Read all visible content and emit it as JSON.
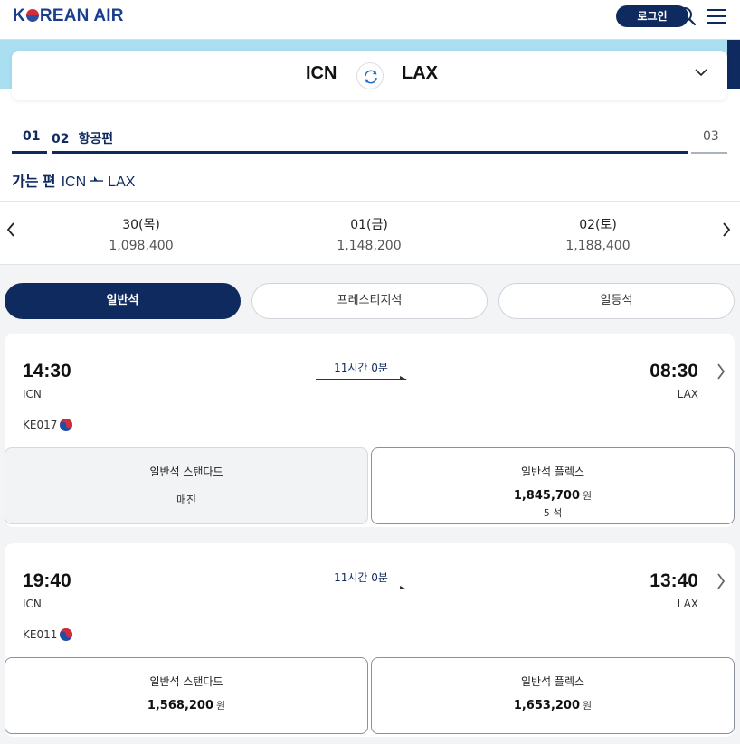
{
  "header": {
    "logo_text": "KOREAN AIR",
    "login_label": "로그인",
    "icons": [
      "search-icon",
      "menu-icon"
    ]
  },
  "route": {
    "from": "ICN",
    "to": "LAX"
  },
  "steps": [
    {
      "number": "01",
      "label": ""
    },
    {
      "number": "02",
      "label": "항공편"
    },
    {
      "number": "03",
      "label": ""
    }
  ],
  "outbound": {
    "label": "가는 편",
    "from": "ICN",
    "to": "LAX"
  },
  "dates": [
    {
      "label": "30(목)",
      "price": "1,098,400"
    },
    {
      "label": "01(금)",
      "price": "1,148,200"
    },
    {
      "label": "02(토)",
      "price": "1,188,400"
    }
  ],
  "cabins": [
    {
      "label": "일반석",
      "selected": true
    },
    {
      "label": "프레스티지석",
      "selected": false
    },
    {
      "label": "일등석",
      "selected": false
    }
  ],
  "flights": [
    {
      "departure_time": "14:30",
      "departure_code": "ICN",
      "arrival_time": "08:30",
      "arrival_code": "LAX",
      "duration": "11시간 0분",
      "flight_number": "KE017",
      "fares": [
        {
          "name": "일반석 스탠다드",
          "status": "매진",
          "price": "",
          "unit": "",
          "seats": ""
        },
        {
          "name": "일반석 플렉스",
          "status": "",
          "price": "1,845,700",
          "unit": "원",
          "seats": "5 석"
        }
      ]
    },
    {
      "departure_time": "19:40",
      "departure_code": "ICN",
      "arrival_time": "13:40",
      "arrival_code": "LAX",
      "duration": "11시간 0분",
      "flight_number": "KE011",
      "fares": [
        {
          "name": "일반석 스탠다드",
          "status": "",
          "price": "1,568,200",
          "unit": "원",
          "seats": ""
        },
        {
          "name": "일반석 플렉스",
          "status": "",
          "price": "1,653,200",
          "unit": "원",
          "seats": ""
        }
      ]
    }
  ],
  "colors": {
    "brand_navy": "#0f2a5f",
    "band_blue": "#a9dff1",
    "logo_blue": "#1a3e8f"
  }
}
